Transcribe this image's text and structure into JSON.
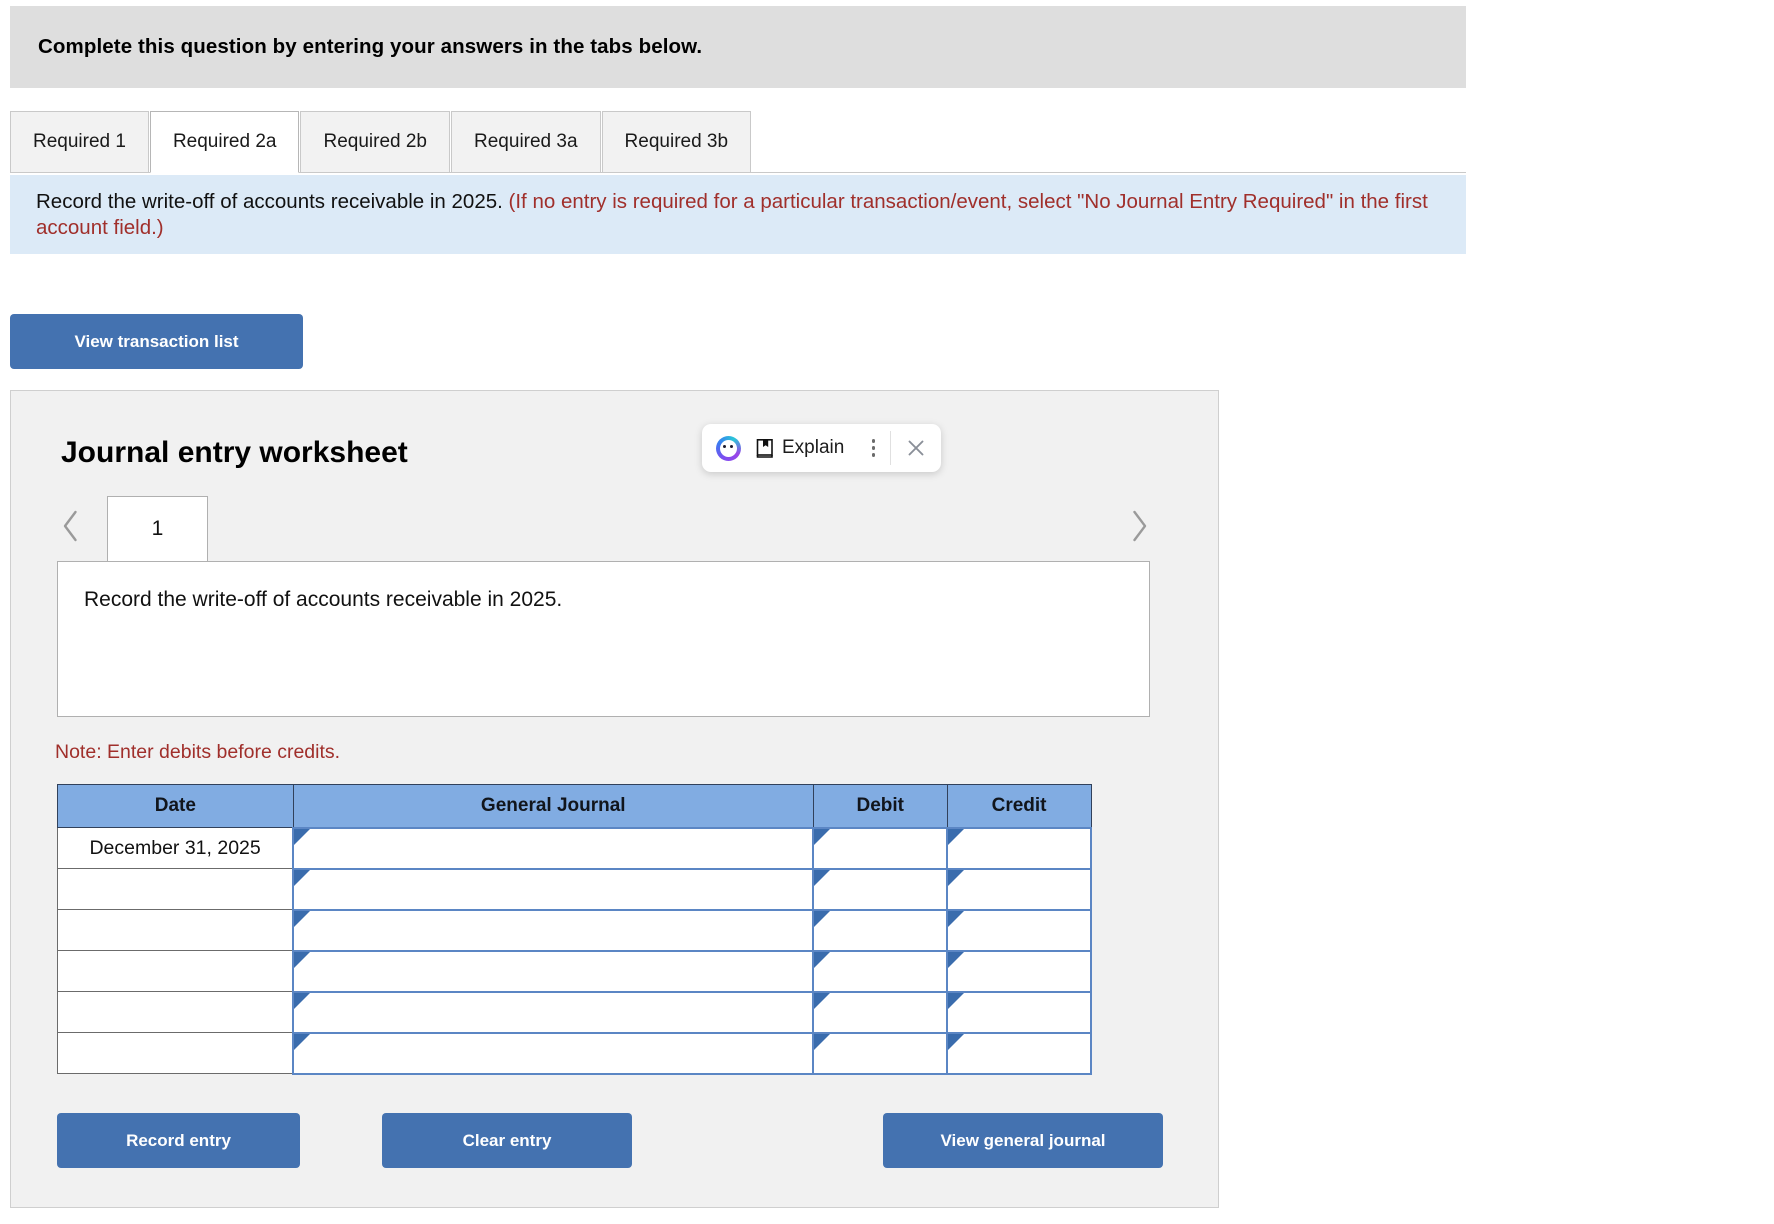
{
  "header": {
    "instruction": "Complete this question by entering your answers in the tabs below."
  },
  "tabs": {
    "items": [
      {
        "label": "Required 1",
        "active": false
      },
      {
        "label": "Required 2a",
        "active": true
      },
      {
        "label": "Required 2b",
        "active": false
      },
      {
        "label": "Required 3a",
        "active": false
      },
      {
        "label": "Required 3b",
        "active": false
      }
    ]
  },
  "banner": {
    "main_text": "Record the write-off of accounts receivable in 2025.",
    "hint_text": "(If no entry is required for a particular transaction/event, select \"No Journal Entry Required\" in the first account field.)",
    "background_color": "#dceaf7",
    "hint_color": "#a02f2b"
  },
  "toolbar": {
    "view_transaction_list_label": "View transaction list"
  },
  "worksheet": {
    "title": "Journal entry worksheet",
    "page_number": "1",
    "prev_icon": "chevron-left-icon",
    "next_icon": "chevron-right-icon",
    "description": "Record the write-off of accounts receivable in 2025.",
    "note": "Note: Enter debits before credits.",
    "note_color": "#a02f2b",
    "panel_background": "#f1f1f1"
  },
  "explain_widget": {
    "brand_icon": "brand-orb-icon",
    "book_icon": "book-bookmark-icon",
    "label": "Explain",
    "menu_icon": "kebab-menu-icon",
    "close_icon": "close-x-icon"
  },
  "journal_table": {
    "columns": [
      "Date",
      "General Journal",
      "Debit",
      "Credit"
    ],
    "header_color": "#81ace2",
    "rows": [
      {
        "date": "December 31, 2025",
        "general_journal": "",
        "debit": "",
        "credit": ""
      },
      {
        "date": "",
        "general_journal": "",
        "debit": "",
        "credit": ""
      },
      {
        "date": "",
        "general_journal": "",
        "debit": "",
        "credit": ""
      },
      {
        "date": "",
        "general_journal": "",
        "debit": "",
        "credit": ""
      },
      {
        "date": "",
        "general_journal": "",
        "debit": "",
        "credit": ""
      },
      {
        "date": "",
        "general_journal": "",
        "debit": "",
        "credit": ""
      }
    ]
  },
  "actions": {
    "record_entry_label": "Record entry",
    "clear_entry_label": "Clear entry",
    "view_general_journal_label": "View general journal",
    "button_color": "#4472b0"
  }
}
